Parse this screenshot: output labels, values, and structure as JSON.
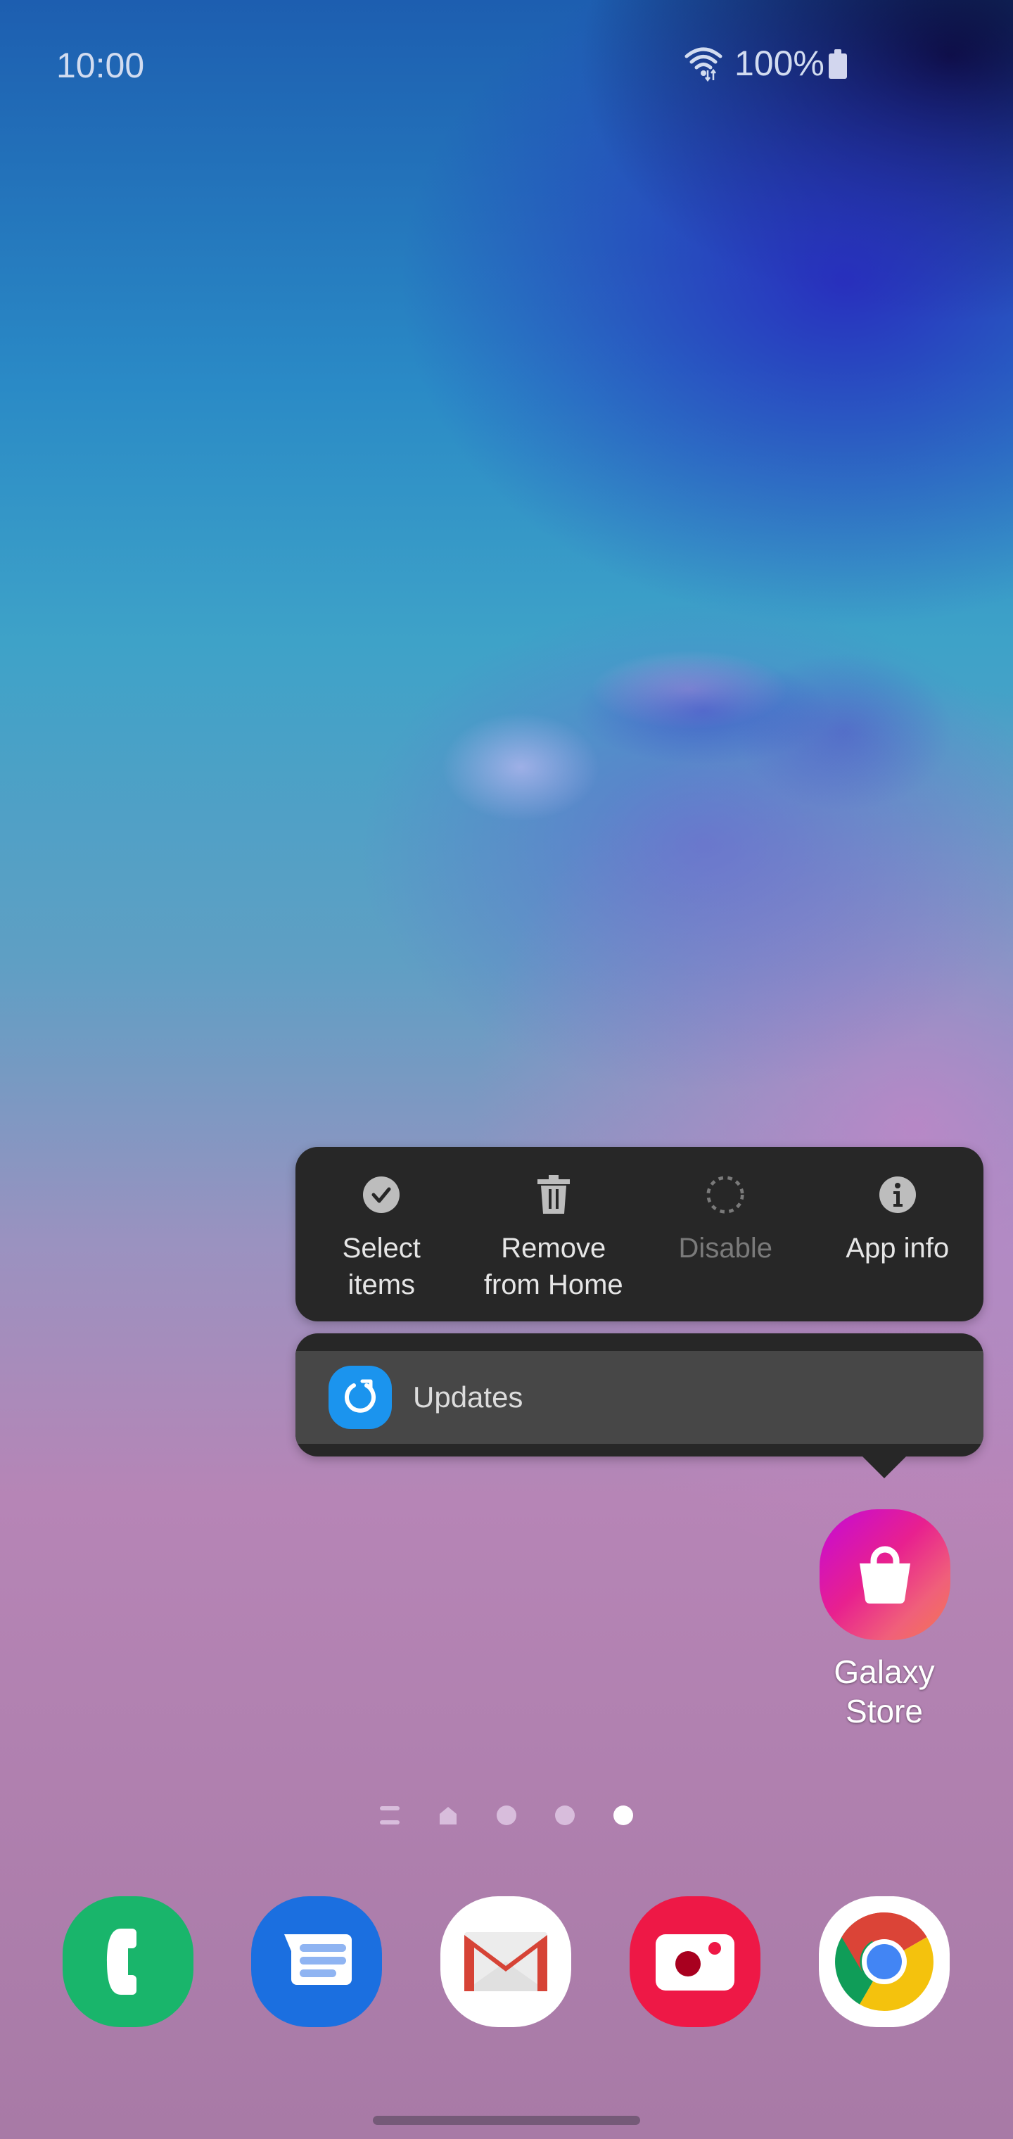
{
  "status_bar": {
    "time": "10:00",
    "wifi_icon": "wifi-data-icon",
    "battery_percent": "100%",
    "battery_icon": "battery-full-icon"
  },
  "context_menu": {
    "actions": [
      {
        "label": "Select\nitems",
        "icon": "check-circle-icon",
        "enabled": true
      },
      {
        "label": "Remove\nfrom Home",
        "icon": "trash-icon",
        "enabled": true
      },
      {
        "label": "Disable",
        "icon": "dashed-circle-icon",
        "enabled": false
      },
      {
        "label": "App info",
        "icon": "info-icon",
        "enabled": true
      }
    ],
    "shortcuts": [
      {
        "label": "Updates",
        "icon": "refresh-icon",
        "icon_color": "#1b94ee"
      }
    ]
  },
  "home_apps": [
    {
      "label": "Galaxy\nStore",
      "icon": "shopping-bag-icon"
    }
  ],
  "page_indicator": {
    "pages": 5,
    "active_index": 4,
    "items": [
      "list",
      "home",
      "page",
      "page",
      "page"
    ]
  },
  "dock": [
    {
      "name": "Phone",
      "icon": "phone-icon",
      "color": "#19b56b"
    },
    {
      "name": "Messages",
      "icon": "messages-icon",
      "color": "#1b6fe0"
    },
    {
      "name": "Gmail",
      "icon": "gmail-icon",
      "color": "#ffffff"
    },
    {
      "name": "Camera",
      "icon": "camera-icon",
      "color": "#ee1846"
    },
    {
      "name": "Chrome",
      "icon": "chrome-icon",
      "color": "#ffffff"
    }
  ]
}
